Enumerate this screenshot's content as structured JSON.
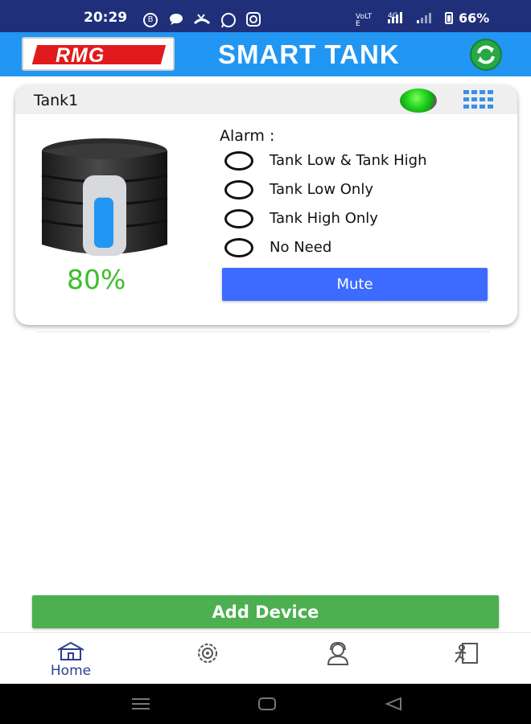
{
  "status_bar": {
    "time": "20:29",
    "notification_icons": [
      "B",
      "chat-icon",
      "missed-call-icon",
      "whatsapp-icon",
      "instagram-icon"
    ],
    "network_label": "VoLTE",
    "network_type": "4G",
    "battery": "66%"
  },
  "app_bar": {
    "logo_text": "RMG",
    "title": "SMART TANK",
    "refresh_icon": "refresh-icon"
  },
  "tank_card": {
    "name": "Tank1",
    "status_color": "#22d21e",
    "level_percent": "80%",
    "level_fraction": 0.8,
    "alarm_label": "Alarm :",
    "alarm_options": [
      {
        "label": "Tank Low & Tank High",
        "selected": false
      },
      {
        "label": "Tank Low Only",
        "selected": false
      },
      {
        "label": "Tank High Only",
        "selected": false
      },
      {
        "label": "No Need",
        "selected": false
      }
    ],
    "mute_label": "Mute"
  },
  "add_device_label": "Add Device",
  "bottom_nav": {
    "items": [
      {
        "icon": "home-icon",
        "label": "Home",
        "active": true
      },
      {
        "icon": "settings-icon",
        "label": "",
        "active": false
      },
      {
        "icon": "support-agent-icon",
        "label": "",
        "active": false
      },
      {
        "icon": "logout-icon",
        "label": "",
        "active": false
      }
    ]
  },
  "colors": {
    "status_bar": "#1f2f7a",
    "app_bar": "#2196f3",
    "mute_button": "#3d6bff",
    "add_device_button": "#4caf50",
    "level_text": "#3ebd2b"
  }
}
